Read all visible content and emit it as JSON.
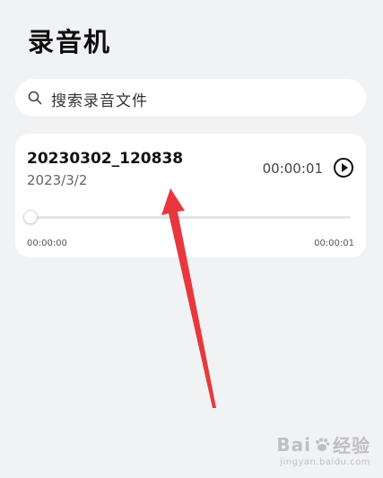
{
  "app": {
    "title": "录音机"
  },
  "search": {
    "placeholder": "搜索录音文件"
  },
  "recordings": [
    {
      "name": "20230302_120838",
      "date": "2023/3/2",
      "duration": "00:00:01",
      "progress_start": "00:00:00",
      "progress_end": "00:00:01",
      "progress_fraction": 0.0
    }
  ],
  "watermark": {
    "brand_pre": "Bai",
    "brand_post": "经验",
    "url": "jingyan.baidu.com"
  },
  "colors": {
    "background": "#f1f2f4",
    "card": "#ffffff",
    "annotation_arrow": "#e8383d"
  },
  "icons": {
    "search": "search-icon",
    "play": "play-icon",
    "watermark_logo": "paw-icon"
  }
}
